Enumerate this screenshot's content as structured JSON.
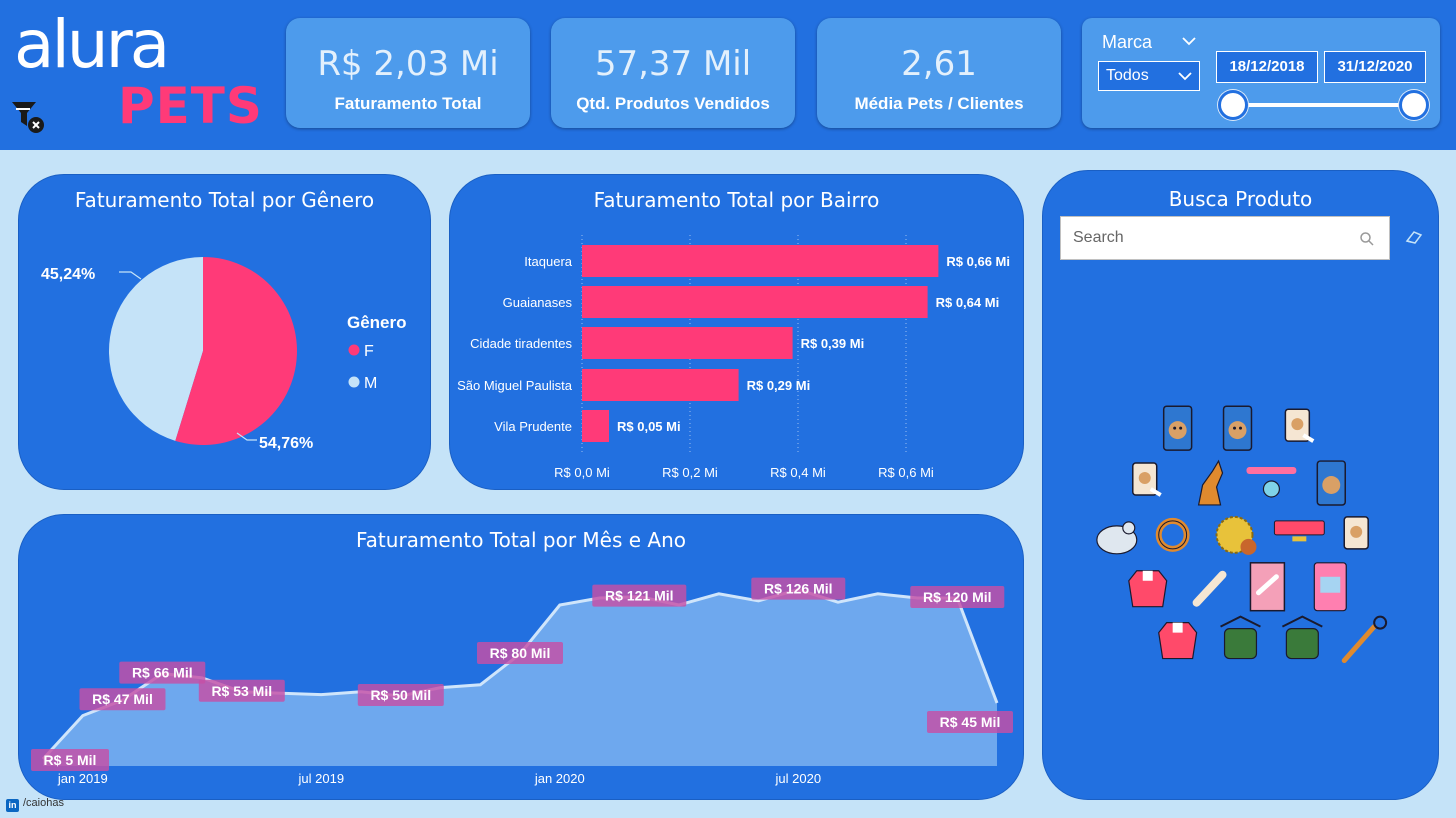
{
  "logo": {
    "brand": "alura",
    "product": "PETS"
  },
  "header": {
    "clear_filters_icon": "filter-clear-icon"
  },
  "kpis": [
    {
      "value": "R$ 2,03 Mi",
      "label": "Faturamento Total"
    },
    {
      "value": "57,37 Mil",
      "label": "Qtd. Produtos Vendidos"
    },
    {
      "value": "2,61",
      "label": "Média Pets / Clientes"
    }
  ],
  "filters": {
    "marca_title": "Marca",
    "marca_selected": "Todos",
    "date_start": "18/12/2018",
    "date_end": "31/12/2020"
  },
  "colors": {
    "accent": "#ff3a78",
    "panel": "#2270e0",
    "kpi": "#4d9bec",
    "light": "#c5e3f8"
  },
  "gender_chart": {
    "title": "Faturamento Total por Gênero",
    "legend_title": "Gênero",
    "label_m": "45,24%",
    "label_f": "54,76%",
    "chart_data": {
      "type": "pie",
      "categories": [
        "F",
        "M"
      ],
      "values": [
        54.76,
        45.24
      ],
      "colors": [
        "#ff3a78",
        "#c5e3f8"
      ],
      "legend": "right"
    }
  },
  "bairro_chart": {
    "title": "Faturamento Total por Bairro",
    "chart_data": {
      "type": "bar",
      "orientation": "horizontal",
      "categories": [
        "Itaquera",
        "Guaianases",
        "Cidade tiradentes",
        "São Miguel Paulista",
        "Vila Prudente"
      ],
      "values": [
        0.66,
        0.64,
        0.39,
        0.29,
        0.05
      ],
      "value_labels": [
        "R$ 0,66 Mi",
        "R$ 0,64 Mi",
        "R$ 0,39 Mi",
        "R$ 0,29 Mi",
        "R$ 0,05 Mi"
      ],
      "xticks": [
        0,
        0.2,
        0.4,
        0.6
      ],
      "xtick_labels": [
        "R$ 0,0 Mi",
        "R$ 0,2 Mi",
        "R$ 0,4 Mi",
        "R$ 0,6 Mi"
      ],
      "xlim": [
        0,
        0.66
      ],
      "color": "#ff3a78",
      "grid": true
    }
  },
  "month_chart": {
    "title": "Faturamento Total por Mês e Ano",
    "chart_data": {
      "type": "area",
      "x": [
        "2018-12",
        "2019-01",
        "2019-02",
        "2019-03",
        "2019-04",
        "2019-05",
        "2019-06",
        "2019-07",
        "2019-08",
        "2019-09",
        "2019-10",
        "2019-11",
        "2019-12",
        "2020-01",
        "2020-02",
        "2020-03",
        "2020-04",
        "2020-05",
        "2020-06",
        "2020-07",
        "2020-08",
        "2020-09",
        "2020-10",
        "2020-11",
        "2020-12"
      ],
      "values": [
        5,
        36,
        47,
        66,
        63,
        53,
        52,
        51,
        53,
        50,
        56,
        58,
        80,
        115,
        120,
        121,
        115,
        123,
        118,
        126,
        117,
        123,
        120,
        120,
        45
      ],
      "ylim": [
        0,
        140
      ],
      "xtick_labels": [
        "jan 2019",
        "jul 2019",
        "jan 2020",
        "jul 2020"
      ],
      "xtick_positions": [
        "2019-01",
        "2019-07",
        "2020-01",
        "2020-07"
      ],
      "annotations": [
        {
          "x": "2018-12",
          "text": "R$ 5 Mil"
        },
        {
          "x": "2019-02",
          "text": "R$ 47 Mil"
        },
        {
          "x": "2019-03",
          "text": "R$ 66 Mil"
        },
        {
          "x": "2019-05",
          "text": "R$ 53 Mil"
        },
        {
          "x": "2019-09",
          "text": "R$ 50 Mil"
        },
        {
          "x": "2019-12",
          "text": "R$ 80 Mil"
        },
        {
          "x": "2020-03",
          "text": "R$ 121 Mil"
        },
        {
          "x": "2020-07",
          "text": "R$ 126 Mil"
        },
        {
          "x": "2020-11",
          "text": "R$ 120 Mil"
        },
        {
          "x": "2020-12",
          "text": "R$ 45 Mil"
        }
      ],
      "fill": "#6ea8ee",
      "line": "#cfe5fb"
    }
  },
  "search": {
    "title": "Busca Produto",
    "placeholder": "Search",
    "products": [
      "pet-food-bag-icon",
      "pet-food-bag-icon",
      "pet-food-bag-icon",
      "pet-food-bag-icon",
      "dog-icon",
      "pet-collar-tag-icon",
      "pet-food-bag-icon",
      "mouse-toy-icon",
      "dog-collar-icon",
      "hedgehog-toy-icon",
      "pet-collar-icon",
      "pet-food-bag-icon",
      "pet-coat-icon",
      "bone-icon",
      "treat-bag-icon",
      "pet-food-can-icon",
      "pet-coat-icon",
      "pet-hanger-icon",
      "pet-hanger-icon",
      "pet-brush-icon"
    ]
  },
  "footer": {
    "linkedin_icon": "in",
    "handle": "/caiohas"
  }
}
